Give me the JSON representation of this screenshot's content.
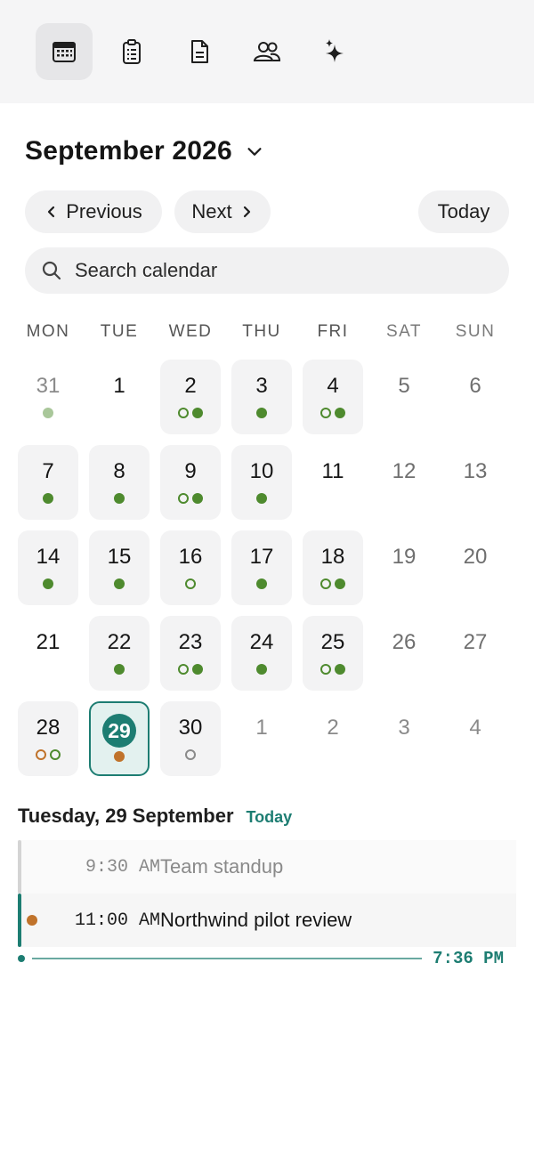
{
  "toolbar": {
    "items": [
      {
        "icon": "calendar-icon",
        "active": true
      },
      {
        "icon": "clipboard-icon",
        "active": false
      },
      {
        "icon": "document-icon",
        "active": false
      },
      {
        "icon": "people-icon",
        "active": false
      },
      {
        "icon": "sparkles-icon",
        "active": false
      }
    ]
  },
  "header": {
    "month_label": "September 2026",
    "previous_label": "Previous",
    "next_label": "Next",
    "today_label": "Today"
  },
  "search": {
    "placeholder": "Search calendar"
  },
  "weekdays": [
    "MON",
    "TUE",
    "WED",
    "THU",
    "FRI",
    "SAT",
    "SUN"
  ],
  "colors": {
    "accent": "#1d7d72",
    "event_green": "#4e8a2e",
    "event_green_light": "#a9c79a",
    "event_orange": "#c0732b",
    "event_gray": "#8a8a8a"
  },
  "calendar": {
    "weeks": [
      [
        {
          "day": "31",
          "other": true,
          "dots": [
            "green-light"
          ]
        },
        {
          "day": "1",
          "dots": []
        },
        {
          "day": "2",
          "bg": true,
          "dots": [
            "green-outline",
            "green"
          ]
        },
        {
          "day": "3",
          "bg": true,
          "dots": [
            "green"
          ]
        },
        {
          "day": "4",
          "bg": true,
          "dots": [
            "green-outline",
            "green"
          ]
        },
        {
          "day": "5",
          "weekend": true,
          "dots": []
        },
        {
          "day": "6",
          "weekend": true,
          "dots": []
        }
      ],
      [
        {
          "day": "7",
          "bg": true,
          "dots": [
            "green"
          ]
        },
        {
          "day": "8",
          "bg": true,
          "dots": [
            "green"
          ]
        },
        {
          "day": "9",
          "bg": true,
          "dots": [
            "green-outline",
            "green"
          ]
        },
        {
          "day": "10",
          "bg": true,
          "dots": [
            "green"
          ]
        },
        {
          "day": "11",
          "dots": []
        },
        {
          "day": "12",
          "weekend": true,
          "dots": []
        },
        {
          "day": "13",
          "weekend": true,
          "dots": []
        }
      ],
      [
        {
          "day": "14",
          "bg": true,
          "dots": [
            "green"
          ]
        },
        {
          "day": "15",
          "bg": true,
          "dots": [
            "green"
          ]
        },
        {
          "day": "16",
          "bg": true,
          "dots": [
            "green-outline"
          ]
        },
        {
          "day": "17",
          "bg": true,
          "dots": [
            "green"
          ]
        },
        {
          "day": "18",
          "bg": true,
          "dots": [
            "green-outline",
            "green"
          ]
        },
        {
          "day": "19",
          "weekend": true,
          "dots": []
        },
        {
          "day": "20",
          "weekend": true,
          "dots": []
        }
      ],
      [
        {
          "day": "21",
          "dots": []
        },
        {
          "day": "22",
          "bg": true,
          "dots": [
            "green"
          ]
        },
        {
          "day": "23",
          "bg": true,
          "dots": [
            "green-outline",
            "green"
          ]
        },
        {
          "day": "24",
          "bg": true,
          "dots": [
            "green"
          ]
        },
        {
          "day": "25",
          "bg": true,
          "dots": [
            "green-outline",
            "green"
          ]
        },
        {
          "day": "26",
          "weekend": true,
          "dots": []
        },
        {
          "day": "27",
          "weekend": true,
          "dots": []
        }
      ],
      [
        {
          "day": "28",
          "bg": true,
          "dots": [
            "orange-outline",
            "green-outline"
          ]
        },
        {
          "day": "29",
          "selected": true,
          "dots": [
            "orange"
          ]
        },
        {
          "day": "30",
          "bg": true,
          "dots": [
            "gray-outline"
          ]
        },
        {
          "day": "1",
          "other": true,
          "dots": []
        },
        {
          "day": "2",
          "other": true,
          "dots": []
        },
        {
          "day": "3",
          "other": true,
          "dots": []
        },
        {
          "day": "4",
          "other": true,
          "dots": []
        }
      ]
    ]
  },
  "agenda": {
    "date_label": "Tuesday, 29 September",
    "today_label": "Today",
    "events": [
      {
        "time": "9:30 AM",
        "title": "Team standup",
        "past": true
      },
      {
        "time": "11:00 AM",
        "title": "Northwind pilot review",
        "past": false
      }
    ],
    "now_time": "7:36 PM"
  }
}
